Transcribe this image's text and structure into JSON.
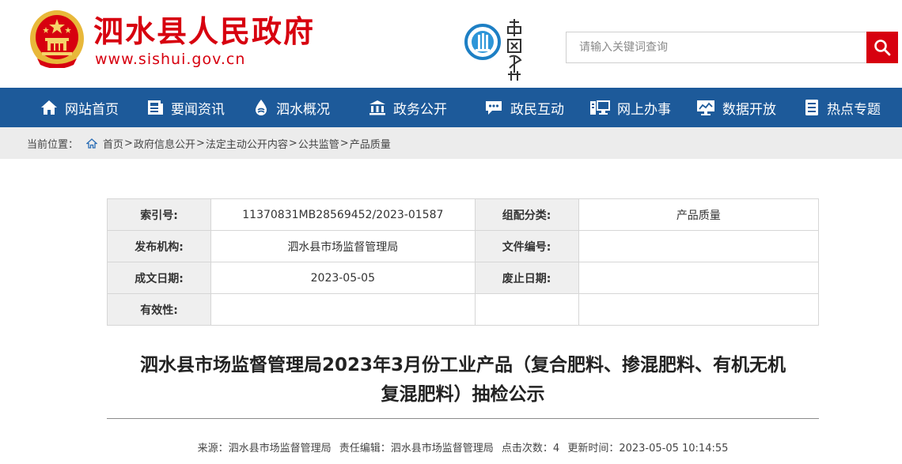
{
  "header": {
    "site_name": "泗水县人民政府",
    "site_url": "www.sishui.gov.cn",
    "search_placeholder": "请输入关键词查询"
  },
  "colors": {
    "brand_red": "#d7000f",
    "nav_blue": "#1d5a9a"
  },
  "nav": {
    "items": [
      {
        "label": "网站首页",
        "icon": "home-icon"
      },
      {
        "label": "要闻资讯",
        "icon": "news-icon"
      },
      {
        "label": "泗水概况",
        "icon": "water-drop-icon"
      },
      {
        "label": "政务公开",
        "icon": "government-building-icon"
      },
      {
        "label": "政民互动",
        "icon": "chat-bubble-icon"
      },
      {
        "label": "网上办事",
        "icon": "office-icon"
      },
      {
        "label": "数据开放",
        "icon": "monitor-icon"
      },
      {
        "label": "热点专题",
        "icon": "document-list-icon"
      }
    ]
  },
  "breadcrumb": {
    "label": "当前位置：",
    "items": [
      "首页",
      "政府信息公开",
      "法定主动公开内容",
      "公共监管",
      "产品质量"
    ],
    "separator": ">"
  },
  "info": {
    "index_label": "索引号:",
    "index_value": "11370831MB28569452/2023-01587",
    "category_label": "组配分类:",
    "category_value": "产品质量",
    "publisher_label": "发布机构:",
    "publisher_value": "泗水县市场监督管理局",
    "doc_no_label": "文件编号:",
    "doc_no_value": "",
    "created_label": "成文日期:",
    "created_value": "2023-05-05",
    "expiry_label": "废止日期:",
    "expiry_value": "",
    "validity_label": "有效性:",
    "validity_value": ""
  },
  "article": {
    "title_line1": "泗水县市场监督管理局2023年3月份工业产品（复合肥料、掺混肥料、有机无机",
    "title_line2": "复混肥料）抽检公示",
    "source": "来源：泗水县市场监督管理局",
    "editor": "责任编辑：泗水县市场监督管理局",
    "views": "点击次数：4",
    "updated": "更新时间：2023-05-05 10:14:55"
  }
}
